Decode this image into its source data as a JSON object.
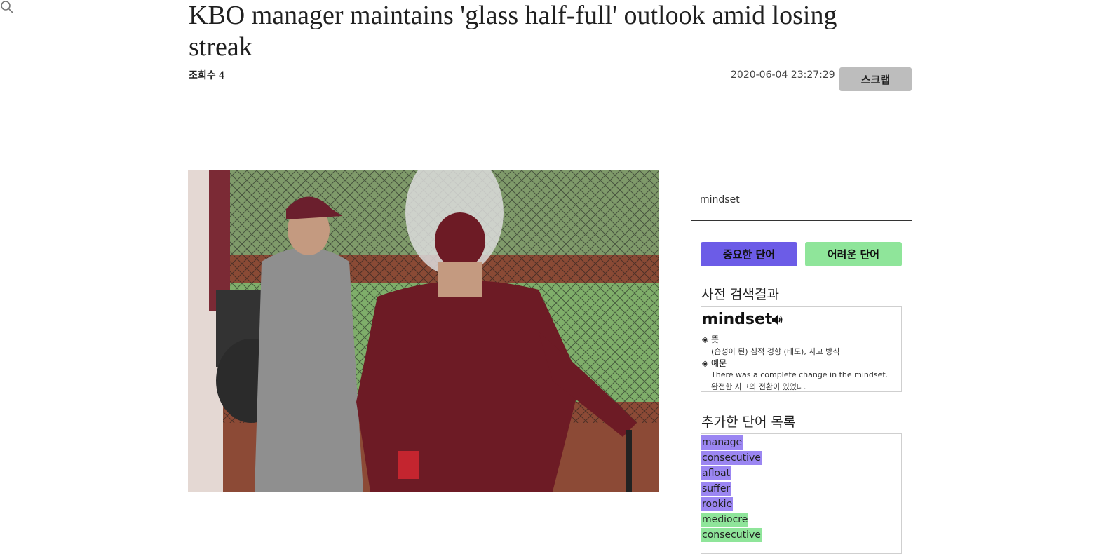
{
  "article": {
    "title": "KBO manager maintains 'glass half-full' outlook amid losing streak",
    "views_label": "조회수",
    "views_count": "4",
    "date": "2020-06-04 23:27:29",
    "scrap_label": "스크랩"
  },
  "sidebar": {
    "search_value": "mindset",
    "important_label": "중요한 단어",
    "difficult_label": "어려운 단어",
    "dict_title": "사전 검색결과",
    "dict": {
      "word": "mindset",
      "meaning_label": "◈ 뜻",
      "meaning": "(습성이 된) 심적 경향 (태도), 사고 방식",
      "example_label": "◈ 예문",
      "example_en": "There was a complete change in the mindset.",
      "example_ko": "완전한 사고의 전환이 있었다."
    },
    "added_title": "추가한 단어 목록",
    "words": [
      {
        "text": "manage",
        "type": "important"
      },
      {
        "text": "consecutive",
        "type": "important"
      },
      {
        "text": "afloat",
        "type": "important"
      },
      {
        "text": "suffer",
        "type": "important"
      },
      {
        "text": "rookie",
        "type": "important"
      },
      {
        "text": "mediocre",
        "type": "difficult"
      },
      {
        "text": "consecutive",
        "type": "difficult"
      }
    ]
  },
  "colors": {
    "important": "#6c5ce7",
    "important_highlight": "#9b86f2",
    "difficult": "#8fe59a",
    "scrap": "#bdbdbd"
  },
  "icons": {
    "search": "search-icon",
    "speaker": "speaker-icon"
  }
}
